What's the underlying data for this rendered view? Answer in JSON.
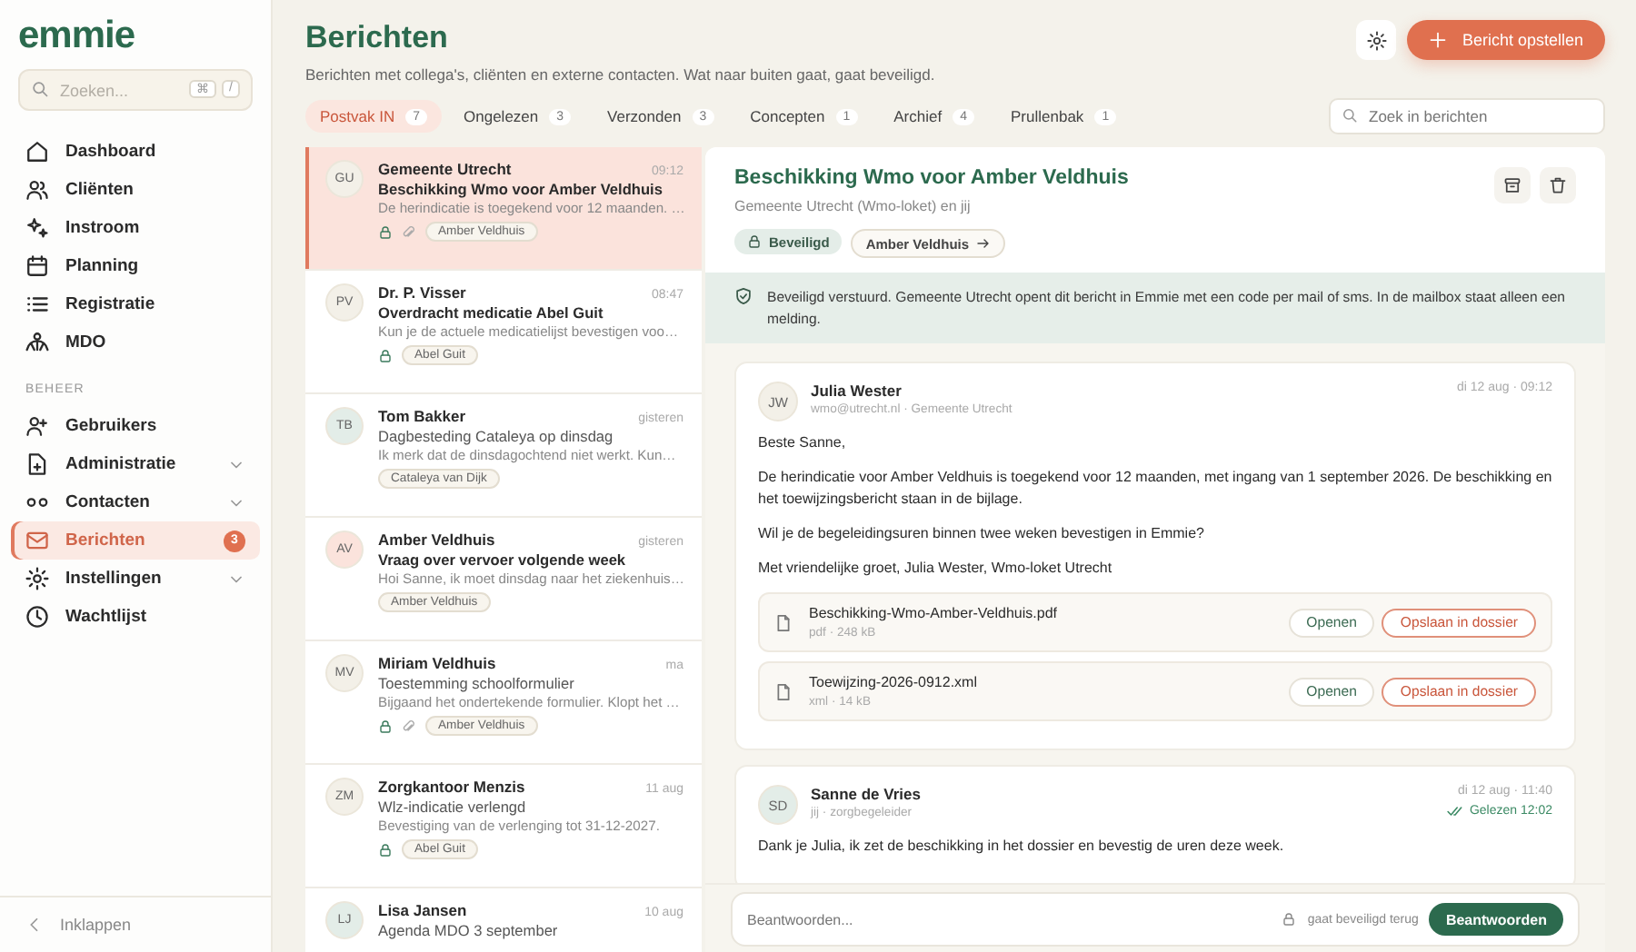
{
  "sidebar": {
    "logo": "emmie",
    "search": {
      "placeholder": "Zoeken...",
      "keys": [
        "⌘",
        "/"
      ]
    },
    "items": [
      {
        "label": "Dashboard",
        "selected": false,
        "has_submenu": false
      },
      {
        "label": "Cliënten",
        "selected": false,
        "has_submenu": false
      },
      {
        "label": "Instroom",
        "selected": false,
        "has_submenu": false
      },
      {
        "label": "Planning",
        "selected": false,
        "has_submenu": false
      },
      {
        "label": "Registratie",
        "selected": false,
        "has_submenu": false
      },
      {
        "label": "MDO",
        "selected": false,
        "has_submenu": false
      }
    ],
    "section_label": "BEHEER",
    "admin_items": [
      {
        "label": "Gebruikers",
        "selected": false,
        "has_submenu": false
      },
      {
        "label": "Administratie",
        "selected": false,
        "has_submenu": true
      },
      {
        "label": "Contacten",
        "selected": false,
        "has_submenu": true
      },
      {
        "label": "Berichten",
        "selected": true,
        "has_submenu": false,
        "badge": "3"
      },
      {
        "label": "Instellingen",
        "selected": false,
        "has_submenu": true
      },
      {
        "label": "Wachtlijst",
        "selected": false,
        "has_submenu": false
      }
    ],
    "collapse": "Inklappen"
  },
  "header": {
    "title": "Berichten",
    "subtitle": "Berichten met collega's, cliënten en externe contacten. Wat naar buiten gaat, gaat beveiligd.",
    "compose_button": "Bericht opstellen"
  },
  "tabs": [
    {
      "label": "Postvak IN",
      "count": "7",
      "selected": true
    },
    {
      "label": "Ongelezen",
      "count": "3",
      "selected": false
    },
    {
      "label": "Verzonden",
      "count": "3",
      "selected": false
    },
    {
      "label": "Concepten",
      "count": "1",
      "selected": false
    },
    {
      "label": "Archief",
      "count": "4",
      "selected": false
    },
    {
      "label": "Prullenbak",
      "count": "1",
      "selected": false
    }
  ],
  "search": {
    "placeholder": "Zoek in berichten"
  },
  "messages": [
    {
      "initials": "GU",
      "color": "#f3f0e8",
      "sender": "Gemeente Utrecht",
      "time": "09:12",
      "subject": "Beschikking Wmo voor Amber Veldhuis",
      "preview": "De herindicatie is toegekend voor 12 maanden. …",
      "unread": true,
      "secure": true,
      "attachment": true,
      "tag": "Amber Veldhuis",
      "selected": true
    },
    {
      "initials": "PV",
      "color": "#f3f0e8",
      "sender": "Dr. P. Visser",
      "time": "08:47",
      "subject": "Overdracht medicatie Abel Guit",
      "preview": "Kun je de actuele medicatielijst bevestigen voo…",
      "unread": true,
      "secure": true,
      "attachment": false,
      "tag": "Abel Guit",
      "selected": false
    },
    {
      "initials": "TB",
      "color": "#e3ede8",
      "sender": "Tom Bakker",
      "time": "gisteren",
      "subject": "Dagbesteding Cataleya op dinsdag",
      "preview": "Ik merk dat de dinsdagochtend niet werkt. Kun…",
      "unread": false,
      "secure": false,
      "attachment": false,
      "tag": "Cataleya van Dijk",
      "selected": false
    },
    {
      "initials": "AV",
      "color": "#fbe3dc",
      "sender": "Amber Veldhuis",
      "time": "gisteren",
      "subject": "Vraag over vervoer volgende week",
      "preview": "Hoi Sanne, ik moet dinsdag naar het ziekenhuis…",
      "unread": true,
      "secure": false,
      "attachment": false,
      "tag": "Amber Veldhuis",
      "selected": false
    },
    {
      "initials": "MV",
      "color": "#f3f0e8",
      "sender": "Miriam Veldhuis",
      "time": "ma",
      "subject": "Toestemming schoolformulier",
      "preview": "Bijgaand het ondertekende formulier. Klopt het …",
      "unread": false,
      "secure": true,
      "attachment": true,
      "tag": "Amber Veldhuis",
      "selected": false
    },
    {
      "initials": "ZM",
      "color": "#f3f0e8",
      "sender": "Zorgkantoor Menzis",
      "time": "11 aug",
      "subject": "Wlz-indicatie verlengd",
      "preview": "Bevestiging van de verlenging tot 31-12-2027.",
      "unread": false,
      "secure": true,
      "attachment": false,
      "tag": "Abel Guit",
      "selected": false
    },
    {
      "initials": "LJ",
      "color": "#e3ede8",
      "sender": "Lisa Jansen",
      "time": "10 aug",
      "subject": "Agenda MDO 3 september",
      "unread": false,
      "secure": false,
      "attachment": false,
      "selected": false
    }
  ],
  "thread": {
    "title": "Beschikking Wmo voor Amber Veldhuis",
    "participants": "Gemeente Utrecht (Wmo-loket) en jij",
    "tags": [
      {
        "label": "Beveiligd",
        "kind": "secure"
      },
      {
        "label": "Amber Veldhuis",
        "kind": "link"
      }
    ],
    "notice": "Beveiligd verstuurd. Gemeente Utrecht opent dit bericht in Emmie met een code per mail of sms. In de mailbox staat alleen een melding.",
    "posts": [
      {
        "initials": "JW",
        "color": "#f3f0e8",
        "sender": "Julia Wester",
        "meta": "wmo@utrecht.nl · Gemeente Utrecht",
        "date": "di 12 aug · 09:12",
        "paragraphs": [
          "Beste Sanne,",
          "De herindicatie voor Amber Veldhuis is toegekend voor 12 maanden, met ingang van 1 september 2026. De beschikking en het toewijzingsbericht staan in de bijlage.",
          "Wil je de begeleidingsuren binnen twee weken bevestigen in Emmie?",
          "Met vriendelijke groet, Julia Wester, Wmo-loket Utrecht"
        ],
        "attachments": [
          {
            "name": "Beschikking-Wmo-Amber-Veldhuis.pdf",
            "meta": "pdf · 248 kB",
            "open": "Openen",
            "save": "Opslaan in dossier"
          },
          {
            "name": "Toewijzing-2026-0912.xml",
            "meta": "xml · 14 kB",
            "open": "Openen",
            "save": "Opslaan in dossier"
          }
        ]
      },
      {
        "initials": "SD",
        "color": "#e3ede8",
        "sender": "Sanne de Vries",
        "meta": "jij · zorgbegeleider",
        "date": "di 12 aug · 11:40",
        "read_receipt": "Gelezen 12:02",
        "paragraphs": [
          "Dank je Julia, ik zet de beschikking in het dossier en bevestig de uren deze week."
        ]
      }
    ]
  },
  "reply": {
    "placeholder": "Beantwoorden...",
    "note": "gaat beveiligd terug",
    "button": "Beantwoorden"
  }
}
